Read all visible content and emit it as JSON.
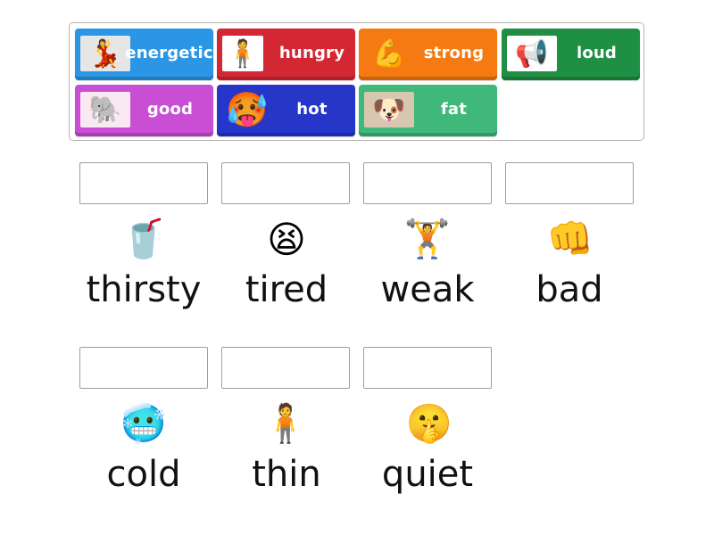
{
  "bank": {
    "tiles": [
      {
        "label": "energetic",
        "color": "#2b96e6",
        "icon": "dancing-woman-photo",
        "glyph": "💃"
      },
      {
        "label": "hungry",
        "color": "#d42734",
        "icon": "hungry-girl-clipart",
        "glyph": "🧍"
      },
      {
        "label": "strong",
        "color": "#f57a11",
        "icon": "flexed-bicep",
        "glyph": "💪"
      },
      {
        "label": "loud",
        "color": "#1f8f44",
        "icon": "shouting-man-photo",
        "glyph": "📢"
      },
      {
        "label": "good",
        "color": "#c84fd3",
        "icon": "elephant-cartoon",
        "glyph": "🐘"
      },
      {
        "label": "hot",
        "color": "#2536c9",
        "icon": "hot-face-emoji",
        "glyph": "🥵"
      },
      {
        "label": "fat",
        "color": "#3fb87a",
        "icon": "fat-dog-photo",
        "glyph": "🐶"
      }
    ]
  },
  "targets": [
    {
      "word": "thirsty",
      "icon": "thirsty-boy-clipart",
      "glyph": "🥤"
    },
    {
      "word": "tired",
      "icon": "tired-girl-clipart",
      "glyph": "😫"
    },
    {
      "word": "weak",
      "icon": "weak-weightlifter-clipart",
      "glyph": "🏋"
    },
    {
      "word": "bad",
      "icon": "angry-fist-clipart",
      "glyph": "👊"
    },
    {
      "word": "cold",
      "icon": "shivering-man-clipart",
      "glyph": "🥶"
    },
    {
      "word": "thin",
      "icon": "thin-boy-photo",
      "glyph": "🧍"
    },
    {
      "word": "quiet",
      "icon": "shushing-woman-photo",
      "glyph": "🤫"
    }
  ]
}
